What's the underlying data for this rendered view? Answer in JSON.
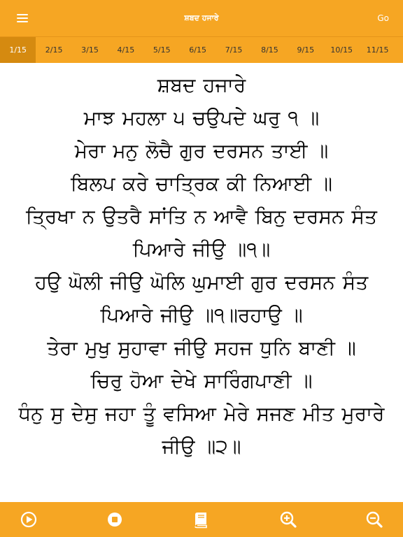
{
  "header": {
    "title": "ਸ਼ਬਦ ਹਜਾਰੇ",
    "go_label": "Go",
    "menu_icon": "hamburger-menu-icon"
  },
  "pages": {
    "items": [
      "1/15",
      "2/15",
      "3/15",
      "4/15",
      "5/15",
      "6/15",
      "7/15",
      "8/15",
      "9/15",
      "10/15",
      "11/15"
    ],
    "active_index": 0
  },
  "content": {
    "lines": [
      "ਸ਼ਬਦ ਹਜਾਰੇ",
      "ਮਾਝ ਮਹਲਾ ੫ ਚਉਪਦੇ ਘਰੁ ੧ ॥",
      "ਮੇਰਾ ਮਨੁ ਲੋਚੈ ਗੁਰ ਦਰਸਨ ਤਾਈ ॥",
      "ਬਿਲਪ ਕਰੇ ਚਾਤ੍ਰਿਕ ਕੀ ਨਿਆਈ ॥",
      "ਤ੍ਰਿਖਾ ਨ ਉਤਰੈ ਸਾਂਤਿ ਨ ਆਵੈ ਬਿਨੁ ਦਰਸਨ ਸੰਤ",
      "ਪਿਆਰੇ ਜੀਉ ॥੧॥",
      "ਹਉ ਘੋਲੀ ਜੀਉ ਘੋਲਿ ਘੁਮਾਈ ਗੁਰ ਦਰਸਨ ਸੰਤ",
      "ਪਿਆਰੇ ਜੀਉ ॥੧॥ਰਹਾਉ ॥",
      "ਤੇਰਾ ਮੁਖੁ ਸੁਹਾਵਾ ਜੀਉ ਸਹਜ ਧੁਨਿ ਬਾਣੀ ॥",
      "ਚਿਰੁ ਹੋਆ ਦੇਖੇ ਸਾਰਿੰਗਪਾਣੀ ॥",
      "ਧੰਨੁ ਸੁ ਦੇਸੁ ਜਹਾ ਤੂੰ ਵਸਿਆ ਮੇਰੇ ਸਜਣ ਮੀਤ ਮੁਰਾਰੇ",
      "ਜੀਉ ॥੨॥"
    ]
  },
  "toolbar": {
    "buttons": [
      "play-icon",
      "stop-icon",
      "book-icon",
      "zoom-in-icon",
      "zoom-out-icon"
    ]
  },
  "colors": {
    "accent": "#f6a623",
    "active_tab": "#d58a10",
    "text": "#000000",
    "icon": "#ffffff"
  }
}
